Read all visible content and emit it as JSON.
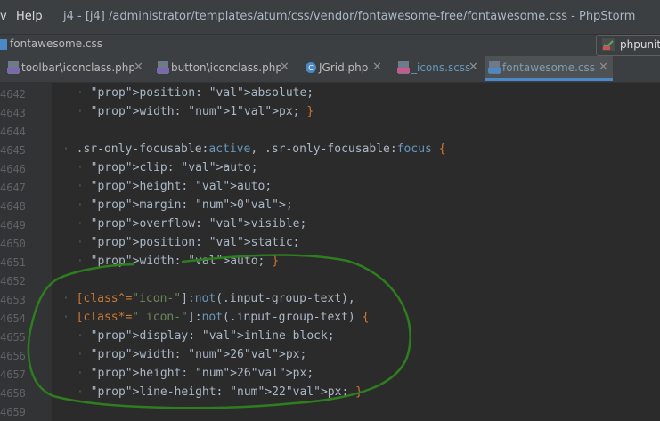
{
  "titlebar": {
    "menu_partial": "v",
    "help": "Help",
    "window_title": "j4 - [j4] /administrator/templates/atum/css/vendor/fontawesome-free/fontawesome.css - PhpStorm"
  },
  "navbar": {
    "crumb": "fontawesome.css",
    "run_config": "phpunit."
  },
  "tabs": [
    {
      "label": "toolbar\\iconclass.php",
      "icon": "php-file-icon"
    },
    {
      "label": "button\\iconclass.php",
      "icon": "php-file-icon"
    },
    {
      "label": "JGrid.php",
      "icon": "php-class-icon"
    },
    {
      "label": "_icons.scss",
      "icon": "sass-file-icon"
    },
    {
      "label": "fontawesome.css",
      "icon": "css-file-icon",
      "active": true
    }
  ],
  "editor": {
    "lines": [
      {
        "n": "4642",
        "text": "position: absolute;"
      },
      {
        "n": "4643",
        "text": "width: 1px; }"
      },
      {
        "n": "4644",
        "text": ""
      },
      {
        "n": "4645",
        "text": ".sr-only-focusable:active, .sr-only-focusable:focus {"
      },
      {
        "n": "4646",
        "text": "clip: auto;"
      },
      {
        "n": "4647",
        "text": "height: auto;"
      },
      {
        "n": "4648",
        "text": "margin: 0;"
      },
      {
        "n": "4649",
        "text": "overflow: visible;"
      },
      {
        "n": "4650",
        "text": "position: static;"
      },
      {
        "n": "4651",
        "text": "width: auto; }"
      },
      {
        "n": "4652",
        "text": ""
      },
      {
        "n": "4653",
        "text": "[class^=\"icon-\"]:not(.input-group-text),"
      },
      {
        "n": "4654",
        "text": "[class*=\" icon-\"]:not(.input-group-text) {"
      },
      {
        "n": "4655",
        "text": "display: inline-block;"
      },
      {
        "n": "4656",
        "text": "width: 26px;"
      },
      {
        "n": "4657",
        "text": "height: 26px;"
      },
      {
        "n": "4658",
        "text": "line-height: 22px; }"
      },
      {
        "n": "4659",
        "text": ""
      }
    ]
  },
  "colors": {
    "background": "#2b2b2b",
    "toolbar": "#3c3f41",
    "accent": "#4a88c7",
    "scribble": "#2e7d1e"
  }
}
